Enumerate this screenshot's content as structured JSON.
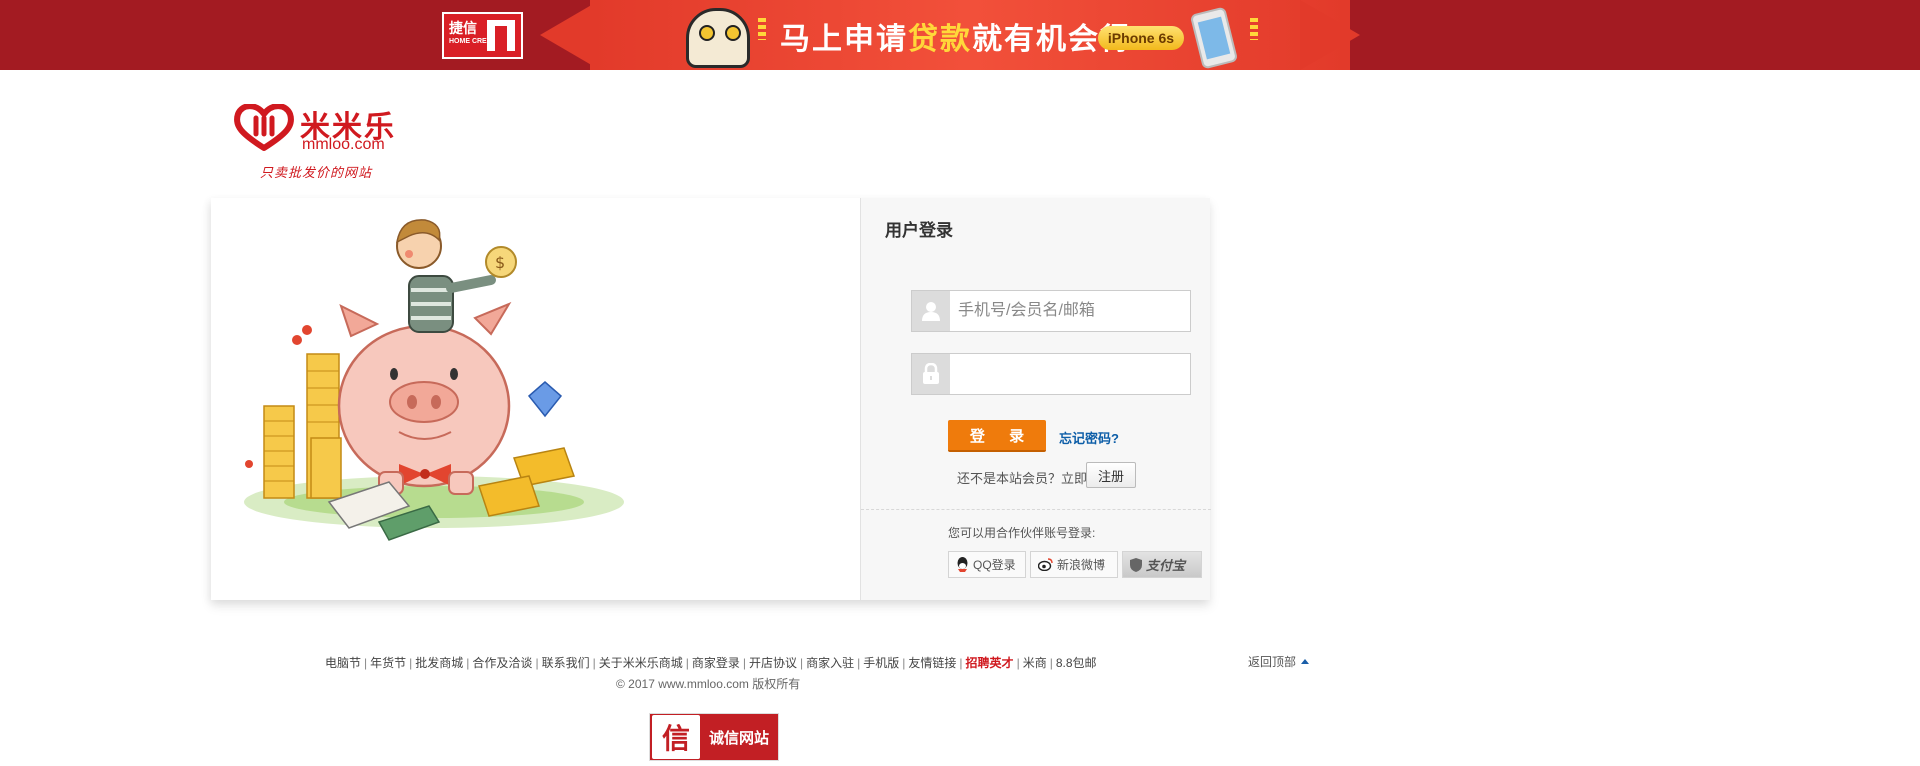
{
  "banner": {
    "brand_cn": "捷信",
    "brand_en": "HOME CREDIT",
    "slogan_part1": "马上申请",
    "slogan_highlight": "贷款",
    "slogan_part2": "就有机会得",
    "prize_badge": "iPhone 6s",
    "colors": {
      "outer": "#a31b22",
      "center": "#e23a2a",
      "highlight": "#ffd83a"
    }
  },
  "site_logo": {
    "name_cn": "米米乐",
    "domain": "mmloo.com",
    "tagline": "只卖批发价的网站"
  },
  "login": {
    "title": "用户登录",
    "username_placeholder": "手机号/会员名/邮箱",
    "password_value": "",
    "login_button": "登 录",
    "forgot_password": "忘记密码?",
    "register_prompt": "还不是本站会员？立即",
    "register_button": "注册",
    "partner_prompt": "您可以用合作伙伴账号登录:",
    "partners": {
      "qq": "QQ登录",
      "weibo": "新浪微博",
      "alipay": "支付宝"
    },
    "accent_color": "#ef7b0c",
    "link_color": "#0d5ea8"
  },
  "footer": {
    "links": [
      {
        "label": "电脑节"
      },
      {
        "label": "年货节"
      },
      {
        "label": "批发商城"
      },
      {
        "label": "合作及洽谈"
      },
      {
        "label": "联系我们"
      },
      {
        "label": "关于米米乐商城"
      },
      {
        "label": "商家登录"
      },
      {
        "label": "开店协议"
      },
      {
        "label": "商家入驻"
      },
      {
        "label": "手机版"
      },
      {
        "label": "友情链接"
      },
      {
        "label": "招聘英才"
      },
      {
        "label": "米商"
      },
      {
        "label": "8.8包邮"
      }
    ],
    "copyright": "© 2017 www.mmloo.com 版权所有",
    "back_to_top": "返回顶部",
    "trust_badge_icon": "信",
    "trust_badge_label": "诚信网站",
    "trust_badge_color": "#c21f24"
  }
}
